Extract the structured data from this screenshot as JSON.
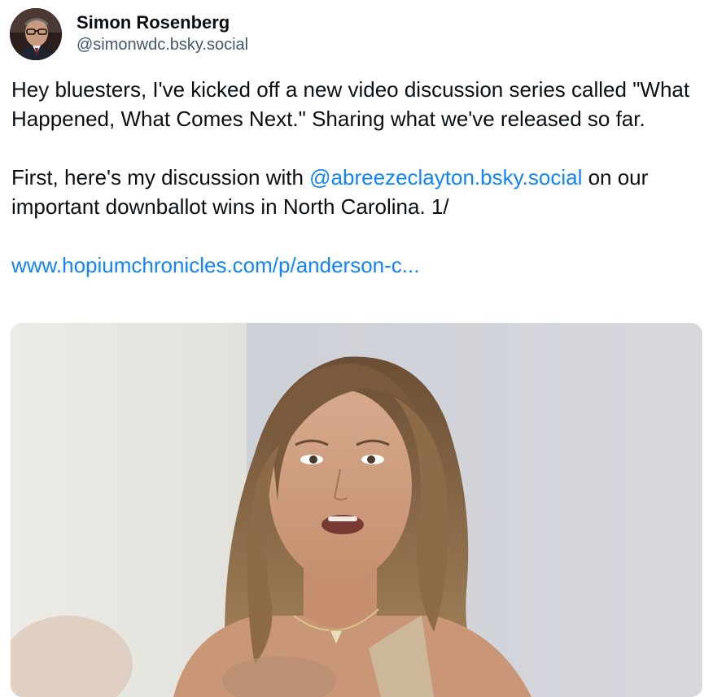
{
  "author": {
    "display_name": "Simon Rosenberg",
    "handle": "@simonwdc.bsky.social"
  },
  "post": {
    "paragraph1": "Hey bluesters, I've kicked off a new video discussion series called \"What Happened, What Comes Next.\"  Sharing what we've released so far.",
    "paragraph2_prefix": "First, here's my discussion with ",
    "paragraph2_mention": "@abreezeclayton.bsky.social",
    "paragraph2_suffix": " on our important downballot wins in North Carolina.  1/",
    "link": "www.hopiumchronicles.com/p/anderson-c..."
  },
  "colors": {
    "link": "#1083fe",
    "handle": "#42576c"
  },
  "media": {
    "type": "video-thumbnail"
  }
}
